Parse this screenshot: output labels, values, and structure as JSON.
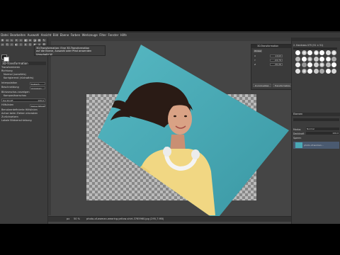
{
  "menu": [
    "Datei",
    "Bearbeiten",
    "Auswahl",
    "Ansicht",
    "Bild",
    "Ebene",
    "Farben",
    "Werkzeuge",
    "Filter",
    "Fenster",
    "Hilfe"
  ],
  "tool_options": {
    "title": "3D-Transformation",
    "rows": [
      {
        "label": "Transformieren",
        "value": ""
      },
      {
        "label": "Richtung",
        "value": ""
      },
      {
        "label": "Normal (vorwärts)",
        "value": ""
      },
      {
        "label": "Korrigierend (rückwärts)",
        "value": ""
      },
      {
        "label": "Interpolation",
        "value": "Kubisch"
      },
      {
        "label": "Beschneidung",
        "value": "Anpassen"
      },
      {
        "label": "Bildvorschau anzeigen",
        "value": ""
      },
      {
        "label": "Kompositvorschau",
        "value": ""
      },
      {
        "label": "Deckkraft",
        "value": "100,0"
      },
      {
        "label": "Hilfslinien",
        "value": "Keine Hilfslinie"
      },
      {
        "label": "Benutzerdefinierte Hilfslinien",
        "value": ""
      },
      {
        "label": "Achse beim Ziehen einrasten",
        "value": ""
      },
      {
        "label": "Zurücksetzen",
        "value": ""
      },
      {
        "label": "Lokale Bildverschiebung",
        "value": ""
      }
    ]
  },
  "tooltip": {
    "lines": [
      "3D-Transformation: Eine 3D-Transformation",
      "auf die Ebene, Auswahl oder Pfad anwenden",
      "Umschalt+W"
    ]
  },
  "dialog": {
    "title": "3D-Transformation",
    "tab": "Winkel",
    "fields": [
      {
        "label": "X",
        "value": "13,63"
      },
      {
        "label": "Y",
        "value": "-22,79"
      },
      {
        "label": "Z",
        "value": "-30,26"
      }
    ],
    "buttons": [
      "Zurücksetzen",
      "Transformation"
    ]
  },
  "brushes_panel": {
    "title": "2. Hardness 075 (51 × 51)",
    "filter_label": "Filter",
    "mode_label": "Modus",
    "mode_value": "Normal",
    "opacity_label": "Deckkraft",
    "opacity_value": "100,0",
    "lock_label": "Sperre:",
    "layers_tab": "Ebenen",
    "layer_name": "photo-of-woman…"
  },
  "status": {
    "unit": "px",
    "zoom": "50 %",
    "file": "photo-of-woman-wearing-yellow-shirt-3765960.jpg (295,7 MB)"
  },
  "colors": {
    "canvas_bg": "#454545",
    "photo_teal": "#4aa9b5"
  }
}
